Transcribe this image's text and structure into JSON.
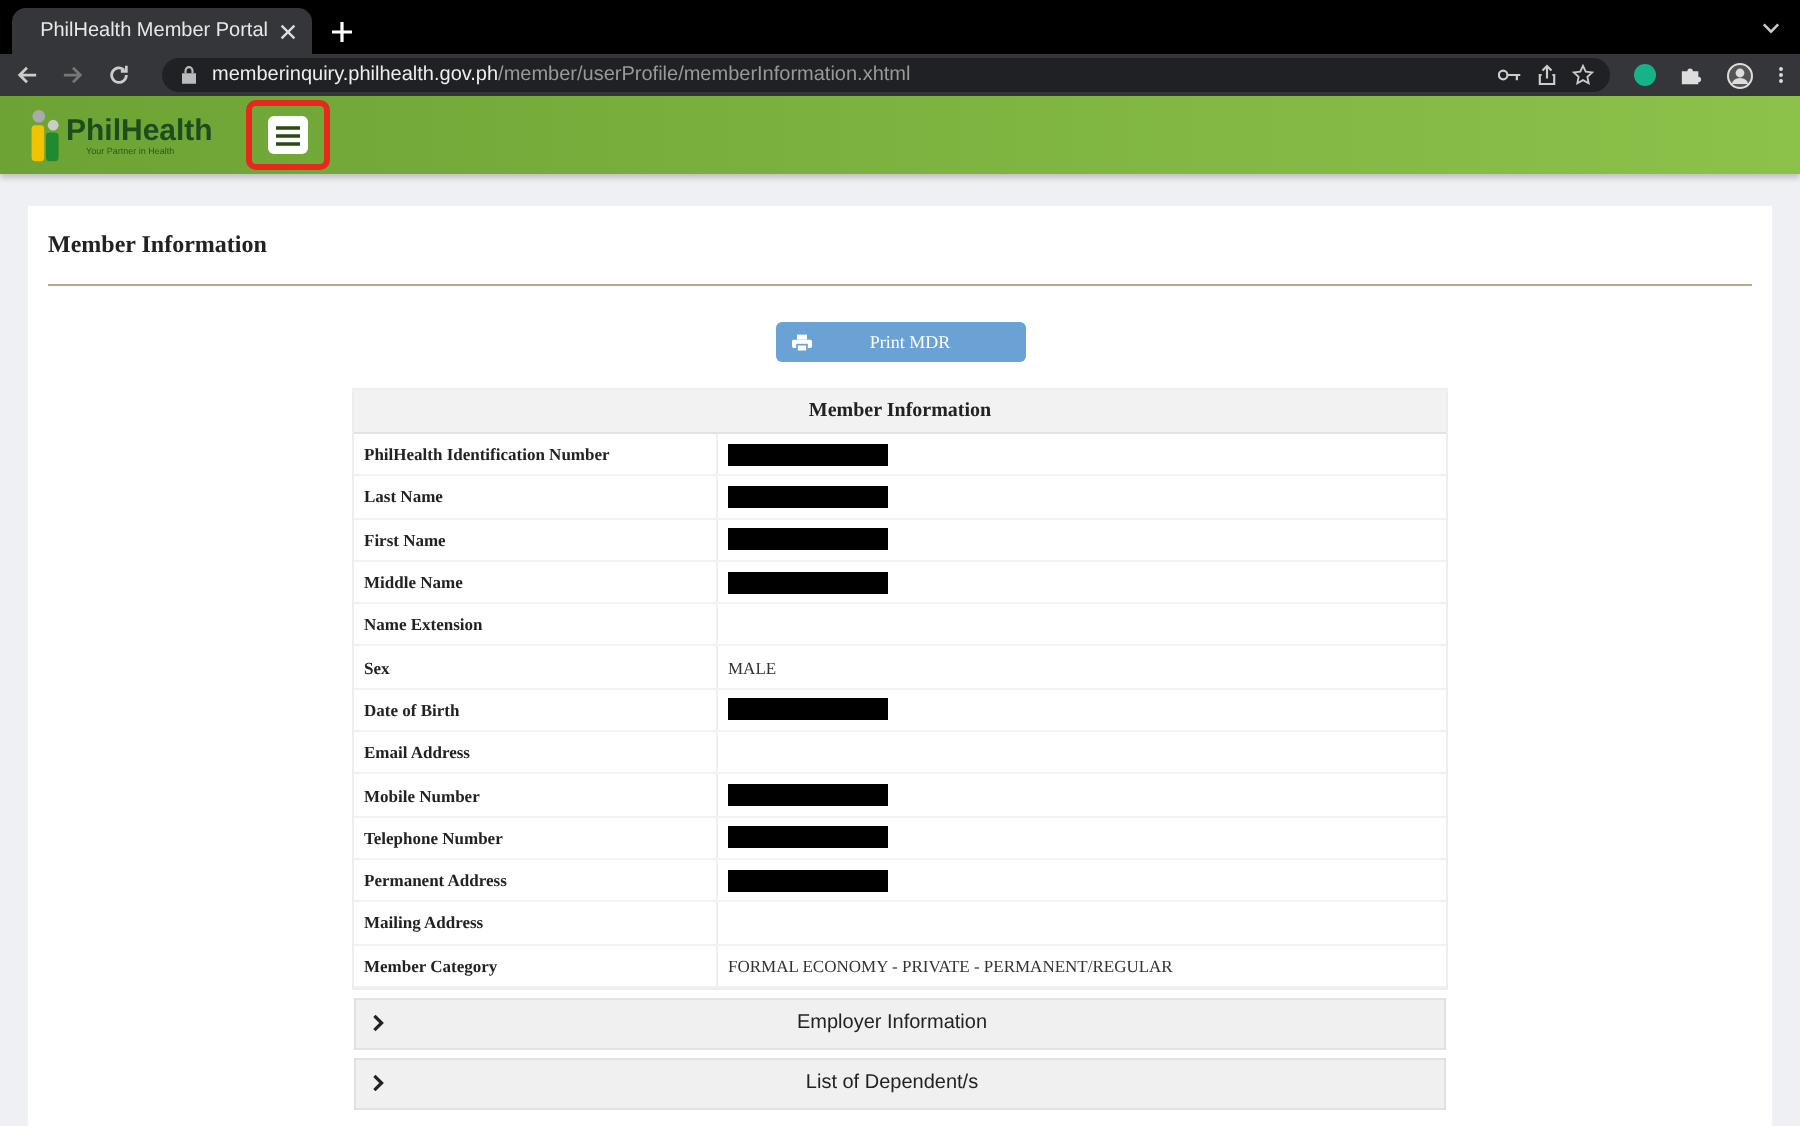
{
  "browser": {
    "tab_title": "PhilHealth Member Portal",
    "url_host": "memberinquiry.philhealth.gov.ph",
    "url_path": "/member/userProfile/memberInformation.xhtml"
  },
  "header": {
    "logo_name": "PhilHealth",
    "logo_tagline": "Your Partner in Health",
    "menu_button": {
      "highlighted": true
    }
  },
  "page": {
    "title": "Member Information",
    "print_button": "Print MDR"
  },
  "table": {
    "title": "Member Information",
    "rows": [
      {
        "label": "PhilHealth Identification Number",
        "redacted": true
      },
      {
        "label": "Last Name",
        "redacted": true
      },
      {
        "label": "First Name",
        "redacted": true
      },
      {
        "label": "Middle Name",
        "redacted": true
      },
      {
        "label": "Name Extension",
        "redacted": false
      },
      {
        "label": "Sex",
        "redacted": false,
        "value": "MALE"
      },
      {
        "label": "Date of Birth",
        "redacted": true
      },
      {
        "label": "Email Address",
        "redacted": false
      },
      {
        "label": "Mobile Number",
        "redacted": true
      },
      {
        "label": "Telephone Number",
        "redacted": true
      },
      {
        "label": "Permanent Address",
        "redacted": true
      },
      {
        "label": "Mailing Address",
        "redacted": false
      },
      {
        "label": "Member Category",
        "redacted": false,
        "value": "FORMAL ECONOMY - PRIVATE - PERMANENT/REGULAR"
      }
    ]
  },
  "sections": [
    {
      "label": "Employer Information",
      "expanded": false
    },
    {
      "label": "List of Dependent/s",
      "expanded": false
    }
  ]
}
